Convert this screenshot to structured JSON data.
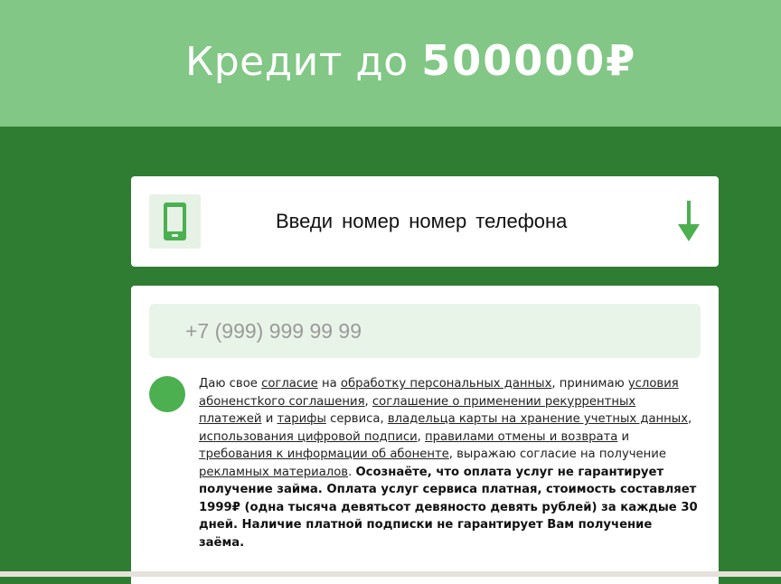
{
  "hero": {
    "title_prefix": "Кредит до",
    "title_amount": "500000₽"
  },
  "phone_card": {
    "title": "Введи номер номер телефона",
    "icon": "smartphone-icon",
    "arrow_icon": "arrow-down-icon"
  },
  "form": {
    "phone_placeholder": "+7 (999) 999 99 99",
    "consent": {
      "t1": "Даю свое ",
      "l1": "согласие",
      "t2": " на ",
      "l2": "обработку персональных данных",
      "t3": ", принимаю ",
      "l3": "условия абоненстkого соглашения",
      "t4": ", ",
      "l4": "соглашение о применении рекуррентных платежей",
      "t5": " и ",
      "l5": "тарифы",
      "t6": " сервиса, ",
      "l6": "владельца карты на хранение учетных данных",
      "t7": ", ",
      "l7": "использования цифровой подписи",
      "t8": ", ",
      "l8": "правилами отмены и возврата",
      "t9": " и ",
      "l9": "требования к информации об абоненте",
      "t10": ", выражаю согласие на получение ",
      "l10": "рекламных материалов",
      "t11": ". ",
      "bold": "Осознаёте, что оплата услуг не гарантирует получение займа. Оплата услуг сервиса платная, стоимость составляет 1999₽ (одна тысяча девятьсот девяносто девять рублей) за каждые 30 дней. Наличие платной подписки не гарантирует Вам получение заёма."
    }
  },
  "colors": {
    "hero_bg": "#82c785",
    "page_bg": "#2f7d33",
    "accent": "#4caf50",
    "input_bg": "#e9f4e9"
  }
}
